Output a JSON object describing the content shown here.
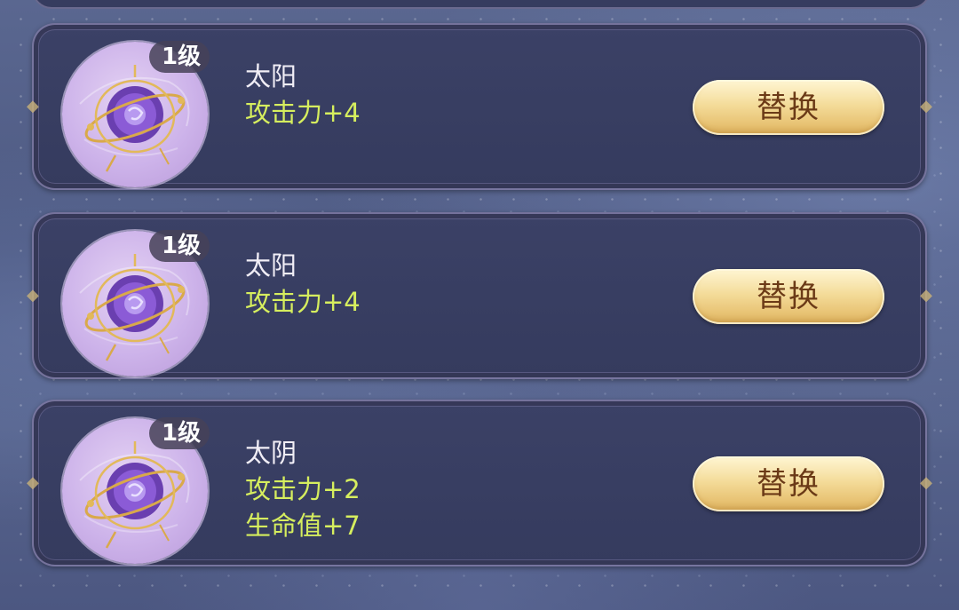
{
  "items": [
    {
      "level": "1级",
      "name": "太阳",
      "stats": [
        "攻击力+4"
      ],
      "button_label": "替换"
    },
    {
      "level": "1级",
      "name": "太阳",
      "stats": [
        "攻击力+4"
      ],
      "button_label": "替换"
    },
    {
      "level": "1级",
      "name": "太阴",
      "stats": [
        "攻击力+2",
        "生命值+7"
      ],
      "button_label": "替换"
    }
  ],
  "icons": {
    "item_icon": "purple-orb-armillary-icon",
    "ornament": "diamond-ornament-icon"
  },
  "colors": {
    "stat_text": "#d6ee5e",
    "name_text": "#f1eef6",
    "button_text": "#6b3a17",
    "card_background": "#383e62"
  }
}
